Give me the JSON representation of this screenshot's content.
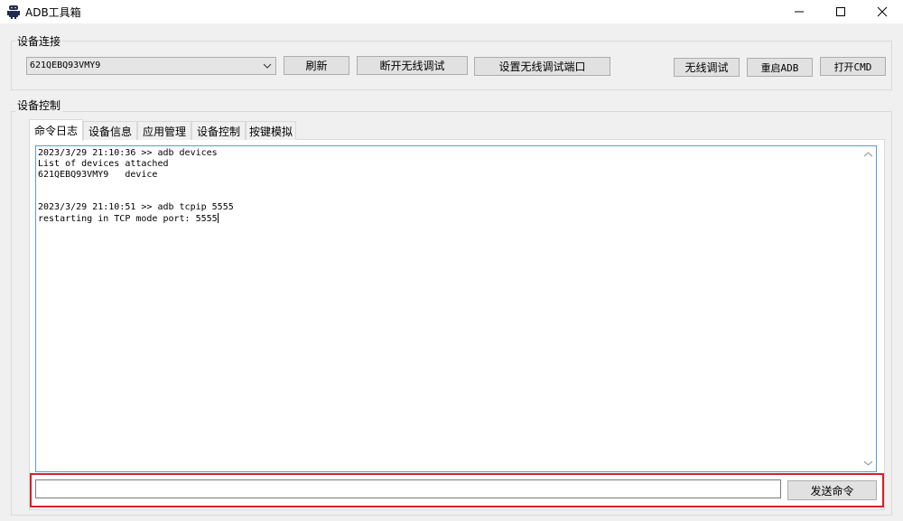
{
  "window": {
    "title": "ADB工具箱",
    "controls": {
      "minimize": "—",
      "maximize": "☐",
      "close": "✕"
    }
  },
  "connection": {
    "group_label": "设备连接",
    "device_select": {
      "selected": "621QEBQ93VMY9"
    },
    "buttons": {
      "refresh": "刷新",
      "disconnect_wireless": "断开无线调试",
      "set_wireless_port": "设置无线调试端口",
      "wireless_debug": "无线调试",
      "restart_adb": "重启ADB",
      "open_cmd": "打开CMD"
    }
  },
  "control": {
    "group_label": "设备控制",
    "tabs": [
      {
        "label": "命令日志",
        "active": true
      },
      {
        "label": "设备信息",
        "active": false
      },
      {
        "label": "应用管理",
        "active": false
      },
      {
        "label": "设备控制",
        "active": false
      },
      {
        "label": "按键模拟",
        "active": false
      }
    ],
    "log": {
      "lines": [
        "2023/3/29 21:10:36 >> adb devices",
        "List of devices attached",
        "621QEBQ93VMY9   device",
        "",
        "",
        "2023/3/29 21:10:51 >> adb tcpip 5555",
        "restarting in TCP mode port: 5555"
      ]
    },
    "command": {
      "input_value": "",
      "send_label": "发送命令"
    }
  },
  "colors": {
    "window_bg": "#f0f0f0",
    "highlight_frame": "#d9202a",
    "focus_border": "#5a9bd5"
  }
}
